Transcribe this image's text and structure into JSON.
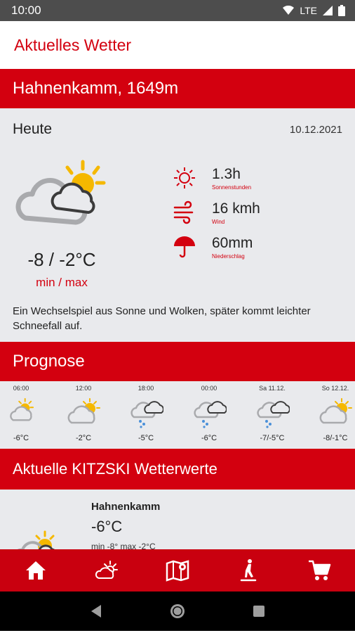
{
  "status": {
    "time": "10:00",
    "network": "LTE"
  },
  "header": {
    "title": "Aktuelles Wetter"
  },
  "location": {
    "title": "Hahnenkamm, 1649m"
  },
  "today": {
    "label": "Heute",
    "date": "10.12.2021",
    "temperature": "-8 / -2°C",
    "temperature_label": "min / max",
    "sun_value": "1.3h",
    "sun_label": "Sonnenstunden",
    "wind_value": "16 kmh",
    "wind_label": "Wind",
    "rain_value": "60mm",
    "rain_label": "Niederschlag",
    "description": "Ein Wechselspiel aus Sonne und Wolken, später kommt leichter Schneefall auf."
  },
  "forecast": {
    "title": "Prognose",
    "items": [
      {
        "time": "06:00",
        "temp": "-6°C",
        "icon": "sun-cloud-icon"
      },
      {
        "time": "12:00",
        "temp": "-2°C",
        "icon": "sun-cloud-icon"
      },
      {
        "time": "18:00",
        "temp": "-5°C",
        "icon": "snow-cloud-icon"
      },
      {
        "time": "00:00",
        "temp": "-6°C",
        "icon": "snow-cloud-icon"
      },
      {
        "time": "Sa 11.12.",
        "temp": "-7/-5°C",
        "icon": "snow-cloud-icon"
      },
      {
        "time": "So 12.12.",
        "temp": "-8/-1°C",
        "icon": "sun-cloud-icon"
      }
    ]
  },
  "kitzski": {
    "title": "Aktuelle KITZSKI Wetterwerte",
    "location": "Hahnenkamm",
    "temperature": "-6°C",
    "minmax": "min -8° max -2°C"
  },
  "nav": {
    "items": [
      "home-icon",
      "weather-icon",
      "map-icon",
      "skier-icon",
      "cart-icon"
    ]
  },
  "colors": {
    "accent": "#d3000f",
    "panel": "#e9eaed"
  }
}
